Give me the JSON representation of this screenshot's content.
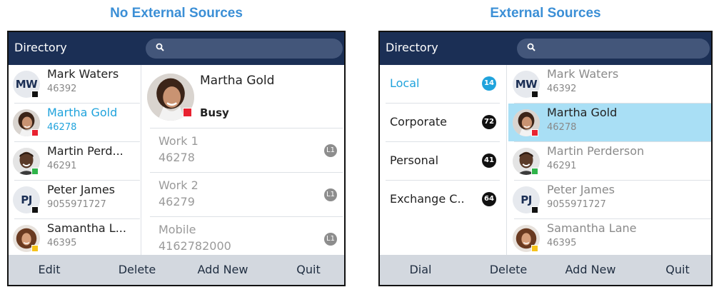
{
  "captions": {
    "left": "No External Sources",
    "right": "External Sources"
  },
  "colors": {
    "header": "#1b2f55",
    "accent": "#20a3dc",
    "footer": "#d3d8df",
    "selected_row": "#a9dff5",
    "busy": "#e82230",
    "online": "#2fb44a",
    "away": "#f6c31a",
    "offline": "#111111"
  },
  "left_screen": {
    "header": {
      "title": "Directory",
      "search_icon": "search-icon",
      "search_placeholder": ""
    },
    "contacts": [
      {
        "name": "Mark Waters",
        "number": "46392",
        "initials": "MW",
        "status": "offline"
      },
      {
        "name": "Martha Gold",
        "number": "46278",
        "photo": "woman-smiling",
        "status": "busy",
        "selected": true
      },
      {
        "name": "Martin Perd...",
        "number": "46291",
        "photo": "man-smiling",
        "status": "online"
      },
      {
        "name": "Peter James",
        "number": "9055971727",
        "initials": "PJ",
        "status": "offline"
      },
      {
        "name": "Samantha L...",
        "number": "46395",
        "photo": "woman-curly",
        "status": "away"
      }
    ],
    "detail": {
      "name": "Martha Gold",
      "status_text": "Busy",
      "rows": [
        {
          "label": "Work 1",
          "value": "46278",
          "line": "L1"
        },
        {
          "label": "Work 2",
          "value": "46279",
          "line": "L1"
        },
        {
          "label": "Mobile",
          "value": "4162782000",
          "line": "L1"
        }
      ]
    },
    "softkeys": [
      "Edit",
      "Delete",
      "Add New",
      "Quit"
    ]
  },
  "right_screen": {
    "header": {
      "title": "Directory",
      "search_icon": "search-icon",
      "search_placeholder": ""
    },
    "sources": [
      {
        "label": "Local",
        "count": "14",
        "selected": true
      },
      {
        "label": "Corporate",
        "count": "72"
      },
      {
        "label": "Personal",
        "count": "41"
      },
      {
        "label": "Exchange C..",
        "count": "64"
      }
    ],
    "contacts": [
      {
        "name": "Mark Waters",
        "number": "46392",
        "initials": "MW",
        "status": "offline"
      },
      {
        "name": "Martha Gold",
        "number": "46278",
        "photo": "woman-smiling",
        "status": "busy",
        "selected": true
      },
      {
        "name": "Martin Perderson",
        "number": "46291",
        "photo": "man-smiling",
        "status": "online"
      },
      {
        "name": "Peter James",
        "number": "9055971727",
        "initials": "PJ",
        "status": "offline"
      },
      {
        "name": "Samantha Lane",
        "number": "46395",
        "photo": "woman-curly",
        "status": "away"
      }
    ],
    "softkeys": [
      "Dial",
      "Delete",
      "Add New",
      "Quit"
    ]
  }
}
